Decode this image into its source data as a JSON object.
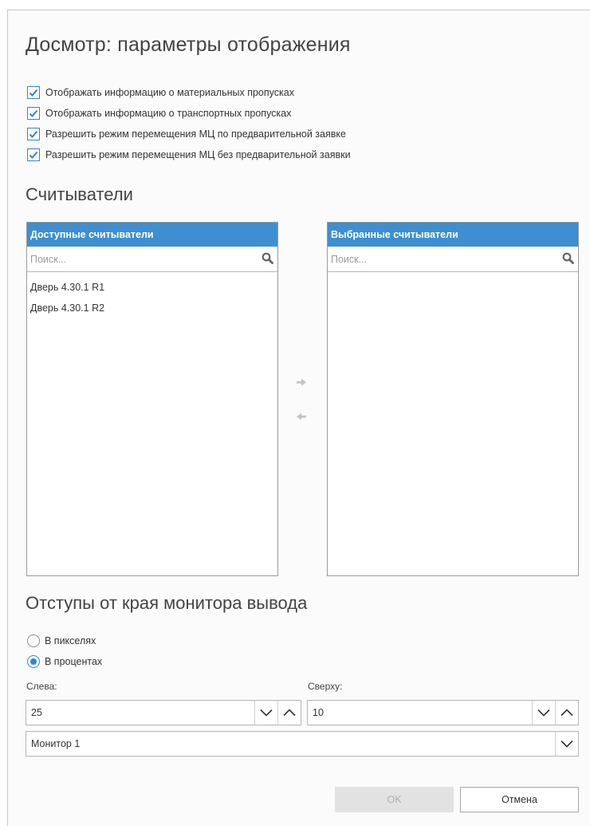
{
  "dialog": {
    "title": "Досмотр: параметры отображения",
    "checkboxes": [
      {
        "label": "Отображать информацию о материальных пропусках",
        "checked": true
      },
      {
        "label": "Отображать информацию о транспортных пропусках",
        "checked": true
      },
      {
        "label": "Разрешить режим перемещения МЦ по предварительной заявке",
        "checked": true
      },
      {
        "label": "Разрешить режим перемещения МЦ без предварительной заявки",
        "checked": true
      }
    ]
  },
  "readers": {
    "section_title": "Считыватели",
    "available": {
      "header": "Доступные считыватели",
      "search_placeholder": "Поиск...",
      "items": [
        "Дверь 4.30.1 R1",
        "Дверь 4.30.1 R2"
      ]
    },
    "selected": {
      "header": "Выбранные считыватели",
      "search_placeholder": "Поиск...",
      "items": []
    },
    "move_right_icon": "arrow-right-icon",
    "move_left_icon": "arrow-left-icon"
  },
  "offsets": {
    "section_title": "Отступы от края монитора вывода",
    "radios": [
      {
        "label": "В пикселях",
        "selected": false
      },
      {
        "label": "В процентах",
        "selected": true
      }
    ],
    "left_label": "Слева:",
    "left_value": "25",
    "top_label": "Сверху:",
    "top_value": "10",
    "monitor_value": "Монитор 1"
  },
  "buttons": {
    "ok": "OK",
    "cancel": "Отмена"
  },
  "colors": {
    "accent": "#3d8fd2",
    "checkbox_border": "#2e86d6"
  }
}
